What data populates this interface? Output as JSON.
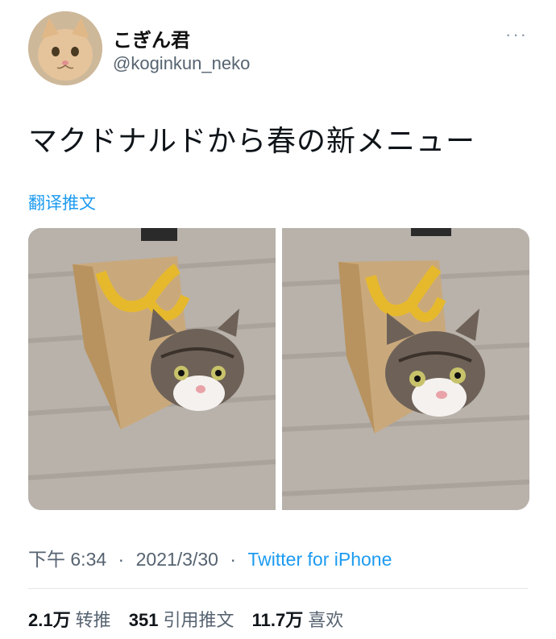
{
  "user": {
    "display_name": "こぎん君",
    "handle": "@koginkun_neko"
  },
  "more_icon": "···",
  "tweet_text": "マクドナルドから春の新メニュー",
  "translate_label": "翻译推文",
  "media": [
    {
      "icon": "photo-cat-in-bag"
    },
    {
      "icon": "photo-cat-in-bag"
    }
  ],
  "meta": {
    "time": "下午 6:34",
    "separator": "·",
    "date": "2021/3/30",
    "source": "Twitter for iPhone"
  },
  "stats": {
    "retweets": {
      "count": "2.1万",
      "label": "转推"
    },
    "quotes": {
      "count": "351",
      "label": "引用推文"
    },
    "likes": {
      "count": "11.7万",
      "label": "喜欢"
    }
  },
  "colors": {
    "link": "#1d9bf0",
    "secondary_text": "#566370",
    "primary_text": "#0f1419"
  }
}
